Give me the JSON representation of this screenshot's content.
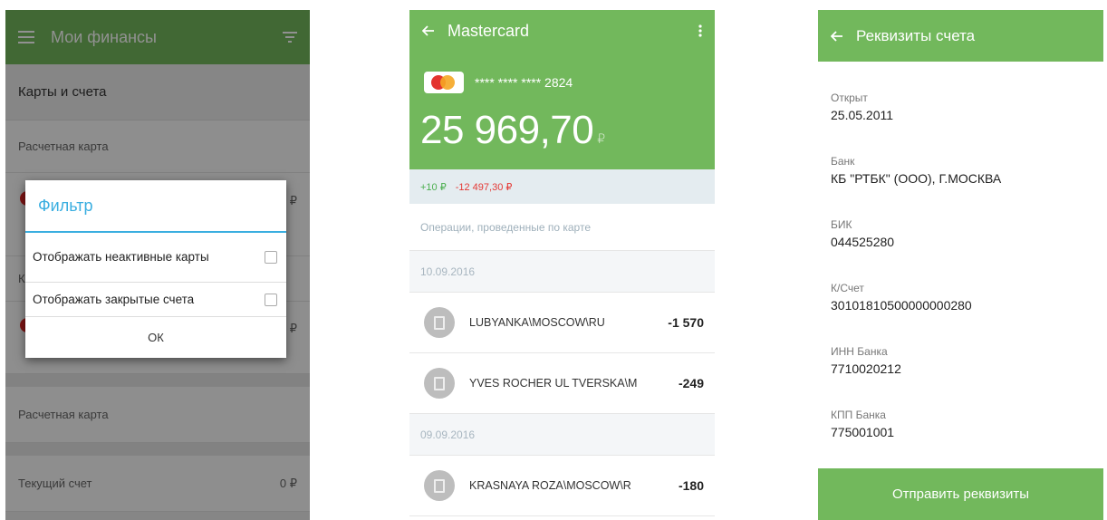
{
  "screen1": {
    "title": "Мои финансы",
    "section": "Карты и счета",
    "rows": [
      {
        "label": "Расчетная карта"
      },
      {
        "label": "Расчетная карта"
      },
      {
        "label": "Текущий счет",
        "amount": "0 ₽"
      }
    ],
    "hidden_amount_1": "₽",
    "hidden_amount_2": "₽",
    "hidden_letter": "К",
    "dialog": {
      "title": "Фильтр",
      "option1": "Отображать неактивные карты",
      "option2": "Отображать закрытые счета",
      "ok": "ОК"
    }
  },
  "screen2": {
    "title": "Mastercard",
    "card_mask": "**** **** **** 2824",
    "balance": "25 969,70",
    "currency": "₽",
    "income": "+10 ₽",
    "expense": "-12 497,30 ₽",
    "ops_label": "Операции, проведенные по карте",
    "groups": [
      {
        "date": "10.09.2016",
        "items": [
          {
            "merchant": "LUBYANKA\\MOSCOW\\RU",
            "amount": "-1 570"
          },
          {
            "merchant": "YVES ROCHER UL TVERSKA\\M",
            "amount": "-249"
          }
        ]
      },
      {
        "date": "09.09.2016",
        "items": [
          {
            "merchant": "KRASNAYA ROZA\\MOSCOW\\R",
            "amount": "-180"
          }
        ]
      }
    ]
  },
  "screen3": {
    "title": "Реквизиты счета",
    "fields": [
      {
        "label": "Открыт",
        "value": "25.05.2011"
      },
      {
        "label": "Банк",
        "value": "КБ \"РТБК\" (ООО), Г.МОСКВА"
      },
      {
        "label": "БИК",
        "value": "044525280"
      },
      {
        "label": "К/Счет",
        "value": "30101810500000000280"
      },
      {
        "label": "ИНН Банка",
        "value": "7710020212"
      },
      {
        "label": "КПП Банка",
        "value": "775001001"
      }
    ],
    "send_button": "Отправить реквизиты"
  },
  "colors": {
    "brand_green": "#72b85c",
    "dialog_accent": "#3aaee0",
    "income": "#4caf50",
    "expense": "#e53935"
  },
  "icons": [
    "menu-icon",
    "filter-icon",
    "back-arrow-icon",
    "overflow-menu-icon",
    "mastercard-logo",
    "receipt-icon",
    "checkbox"
  ]
}
